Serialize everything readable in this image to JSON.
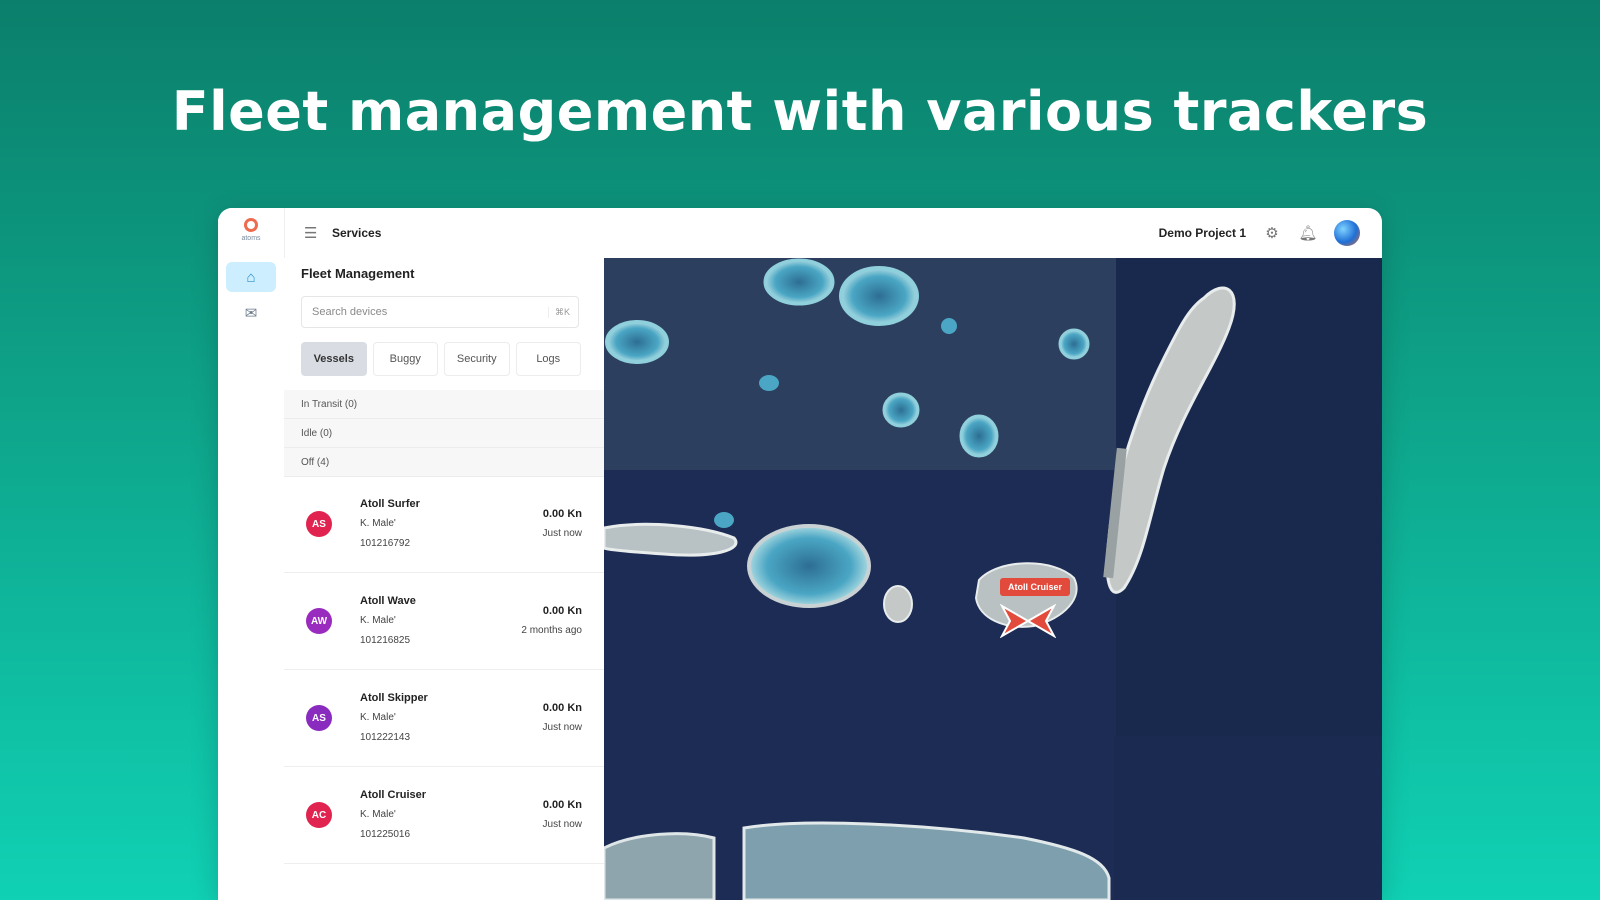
{
  "headline": "Fleet management with various trackers",
  "app": {
    "logo_text": "atoms",
    "topbar": {
      "menu_icon": "menu-icon",
      "title": "Services",
      "project": "Demo Project 1"
    },
    "rail": {
      "items": [
        {
          "icon": "home-icon",
          "active": true
        },
        {
          "icon": "mail-icon",
          "active": false
        }
      ]
    },
    "panel": {
      "title": "Fleet Management",
      "search": {
        "placeholder": "Search devices",
        "shortcut": "⌘K"
      },
      "tabs": [
        {
          "label": "Vessels",
          "active": true
        },
        {
          "label": "Buggy",
          "active": false
        },
        {
          "label": "Security",
          "active": false
        },
        {
          "label": "Logs",
          "active": false
        }
      ],
      "groups": [
        {
          "label": "In Transit (0)"
        },
        {
          "label": "Idle (0)"
        },
        {
          "label": "Off (4)"
        }
      ],
      "devices": [
        {
          "initials": "AS",
          "name": "Atoll Surfer",
          "location": "K. Male'",
          "id": "101216792",
          "speed": "0.00 Kn",
          "time": "Just now",
          "color": "#e0244f"
        },
        {
          "initials": "AW",
          "name": "Atoll Wave",
          "location": "K. Male'",
          "id": "101216825",
          "speed": "0.00 Kn",
          "time": "2 months ago",
          "color": "#9a2bbf"
        },
        {
          "initials": "AS",
          "name": "Atoll Skipper",
          "location": "K. Male'",
          "id": "101222143",
          "speed": "0.00 Kn",
          "time": "Just now",
          "color": "#8a2bbf"
        },
        {
          "initials": "AC",
          "name": "Atoll Cruiser",
          "location": "K. Male'",
          "id": "101225016",
          "speed": "0.00 Kn",
          "time": "Just now",
          "color": "#e0244f"
        }
      ]
    },
    "map": {
      "vessel_label": "Atoll Cruiser",
      "marker_color": "#e24a3b"
    }
  }
}
